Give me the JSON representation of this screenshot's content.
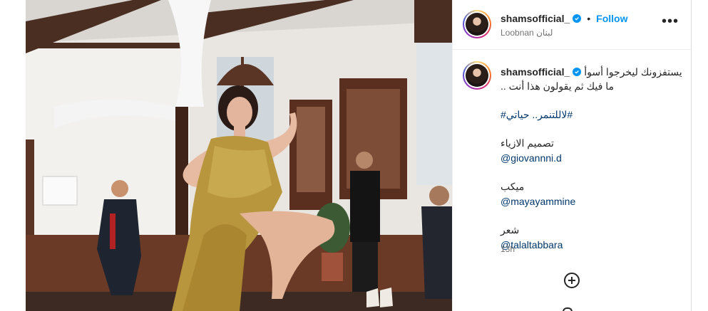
{
  "post": {
    "username": "shamsofficial_",
    "follow_label": "Follow",
    "separator": "•",
    "location": "Loobnan لبنان",
    "more_label": "•••",
    "caption": {
      "username": "shamsofficial_",
      "line1": "يستفزونك ليخرجوا أسوأ",
      "line2": "ما فيك ثم يقولون هذا أنت ..",
      "hashtags": "#لاللتنمر.. حياتي#",
      "credits": [
        {
          "label": "تصميم الازياء",
          "handle": "@giovannni.d"
        },
        {
          "label": "ميكب",
          "handle": "@mayayammine"
        },
        {
          "label": "شعر",
          "handle": "@talaltabbara"
        }
      ]
    },
    "time": "13h"
  },
  "icons": {
    "verified": "verified-badge-icon",
    "more": "more-options-icon",
    "add": "add-comment-icon"
  },
  "colors": {
    "accent": "#0095f6",
    "link": "#00376b",
    "muted": "#737373",
    "dress_gold": "#b8963e"
  }
}
